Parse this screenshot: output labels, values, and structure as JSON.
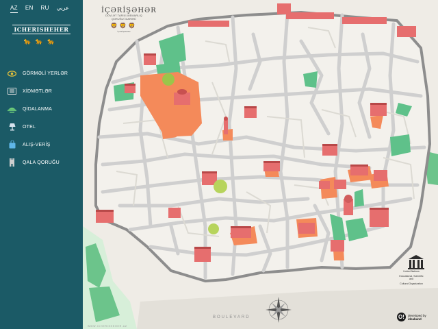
{
  "languages": [
    {
      "code": "AZ",
      "active": true
    },
    {
      "code": "EN",
      "active": false
    },
    {
      "code": "RU",
      "active": false
    },
    {
      "code": "عربي",
      "active": false
    }
  ],
  "logo": {
    "text": "ICHERISHEHER",
    "animals": "🐆🐆🐆"
  },
  "menu": [
    {
      "label": "GÖRMƏLİ YERLƏR",
      "icon": "eye-icon",
      "color": "#e6c23a"
    },
    {
      "label": "XİDMƏTLƏR",
      "icon": "services-icon",
      "color": "#dddddd"
    },
    {
      "label": "QİDALANMA",
      "icon": "food-icon",
      "color": "#6fce7a"
    },
    {
      "label": "OTEL",
      "icon": "lamp-icon",
      "color": "#d8e4ef"
    },
    {
      "label": "ALIŞ-VERİŞ",
      "icon": "shopping-bag-icon",
      "color": "#5fb6e8"
    },
    {
      "label": "QALA QORUĞU",
      "icon": "tower-icon",
      "color": "#cfcfcf"
    }
  ],
  "map": {
    "title": "İÇƏRİŞƏHƏR",
    "subtitle_1": "DÖVLƏT TARİXİ-MEMARLIQ",
    "subtitle_2": "QORUĞU İDARƏSİ",
    "lions": "🦁🦁🦁",
    "small_text": "İÇƏRİŞƏHƏR",
    "boulevard": "BOULEVARD",
    "website": "WWW.ICHERISHEHER.AZ",
    "compass": "compass-rose-icon"
  },
  "unesco": {
    "logo": "UNESCO",
    "line1": "United Nations",
    "line2": "Educational, Scientific and",
    "line3": "Cultural Organization"
  },
  "developer": {
    "logo": "O!",
    "line1": "developed by",
    "line2": "ideaband"
  },
  "colors": {
    "sidebar": "#1b5a66",
    "building": "#e67070",
    "plaza": "#f48a5a",
    "park": "#5fc18a",
    "road": "#cfcfcf",
    "wall": "#8d8d8d"
  }
}
